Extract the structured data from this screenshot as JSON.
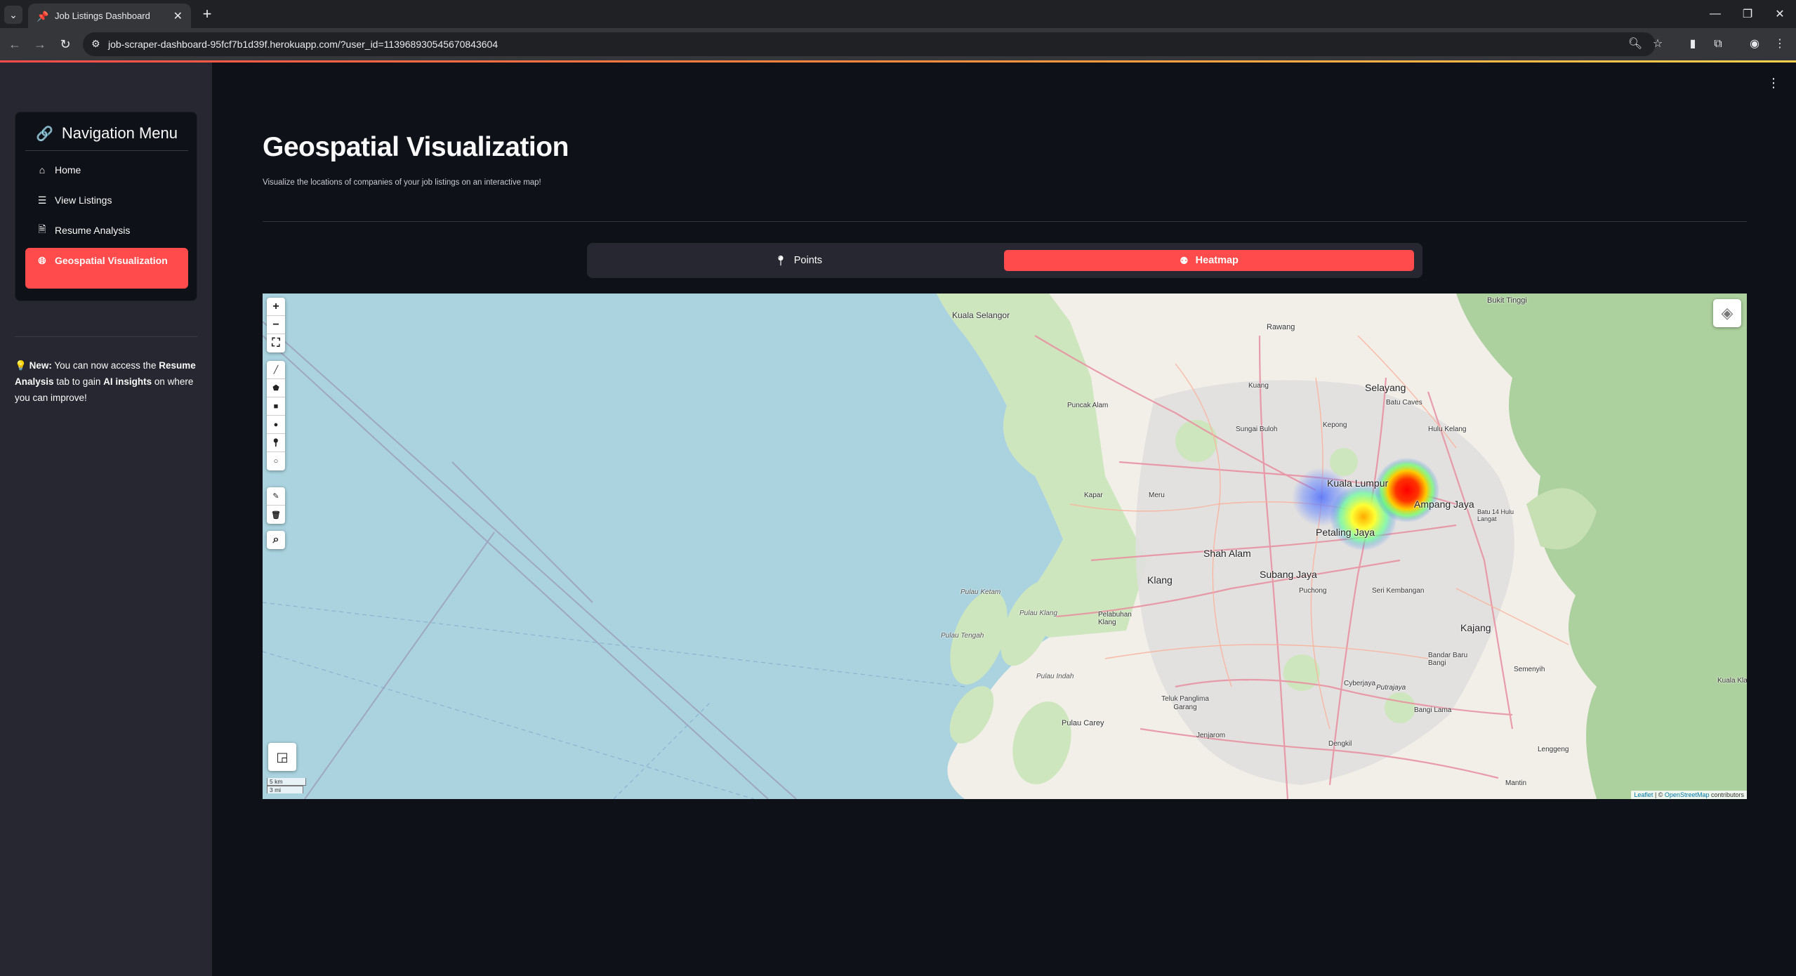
{
  "browser": {
    "tab_title": "Job Listings Dashboard",
    "url": "job-scraper-dashboard-95fcf7b1d39f.herokuapp.com/?user_id=113968930545670843604"
  },
  "sidebar": {
    "menu_title": "Navigation Menu",
    "items": [
      {
        "label": "Home",
        "icon": "home-icon"
      },
      {
        "label": "View Listings",
        "icon": "list-icon"
      },
      {
        "label": "Resume Analysis",
        "icon": "document-icon"
      },
      {
        "label": "Geospatial Visualization",
        "icon": "globe-icon",
        "active": true
      }
    ],
    "note": {
      "emoji": "💡",
      "new_label": "New:",
      "text_1": " You can now access the ",
      "resume_label": "Resume Analysis",
      "text_2": " tab to gain ",
      "ai_label": "AI insights",
      "text_3": " on where you can improve!"
    }
  },
  "main": {
    "title": "Geospatial Visualization",
    "subtitle": "Visualize the locations of companies of your job listings on an interactive map!",
    "tabs": [
      {
        "label": "Points",
        "icon": "map-pin-icon",
        "active": false
      },
      {
        "label": "Heatmap",
        "icon": "heatmap-icon",
        "active": true
      }
    ]
  },
  "map": {
    "scale_km": "5 km",
    "scale_mi": "3 mi",
    "attribution_leaflet": "Leaflet",
    "attribution_sep": " | © ",
    "attribution_osm": "OpenStreetMap",
    "attribution_tail": " contributors",
    "places": [
      "Kuala Selangor",
      "Rawang",
      "Bukit Tinggi",
      "Selayang",
      "Batu Caves",
      "Puncak Alam",
      "Kuang",
      "Kepong",
      "Sungai Buloh",
      "Hulu Kelang",
      "Kuala Lumpur",
      "Ampang Jaya",
      "Kapar",
      "Meru",
      "Petaling Jaya",
      "Batu 14 Hulu Langat",
      "Shah Alam",
      "Subang Jaya",
      "Klang",
      "Puchong",
      "Seri Kembangan",
      "Pulau Ketam",
      "Pulau Klang",
      "Pelabuhan Klang",
      "Kajang",
      "Pulau Tengah",
      "Bandar Baru Bangi",
      "Cyberjaya",
      "Putrajaya",
      "Semenyih",
      "Pulau Indah",
      "Teluk Panglima Garang",
      "Bangi Lama",
      "Pulau Carey",
      "Jenjarom",
      "Dengkil",
      "Lenggeng",
      "Mantin",
      "Kuala Klawang"
    ]
  },
  "colors": {
    "accent": "#ff4b4b",
    "app_bg": "#0e1117",
    "sidebar_bg": "#262730",
    "sea": "#aad3df",
    "land": "#f2efe9",
    "forest": "#add19e"
  }
}
